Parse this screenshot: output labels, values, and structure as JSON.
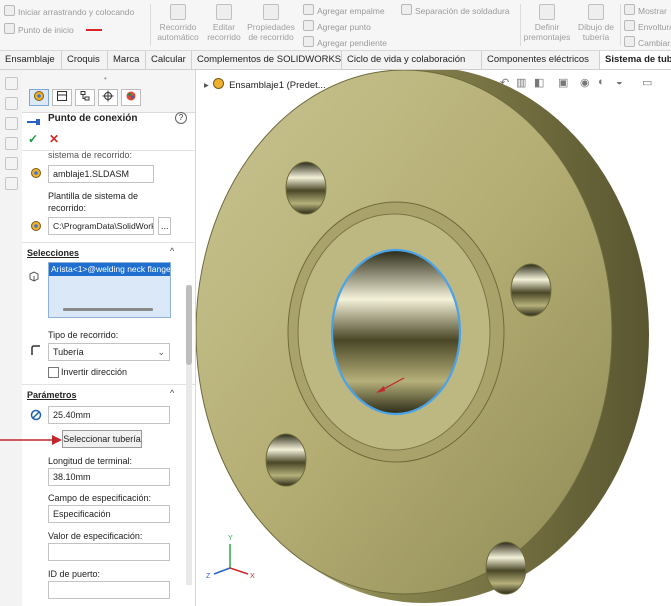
{
  "ribbon": {
    "small_items": [
      {
        "icon": "drag-route-icon",
        "label": "Iniciar arrastrando y colocando"
      },
      {
        "icon": "connection-point-icon",
        "label": "Punto de inicio"
      },
      {
        "icon": "add-elbow-icon",
        "label": "Agregar empalme"
      },
      {
        "icon": "add-point-icon",
        "label": "Agregar punto"
      },
      {
        "icon": "add-slope-icon",
        "label": "Agregar pendiente"
      },
      {
        "icon": "weld-gap-icon",
        "label": "Separación de soldadura"
      },
      {
        "icon": "show-icon",
        "label": "Mostrar"
      },
      {
        "icon": "covering-icon",
        "label": "Envoltura"
      },
      {
        "icon": "change-icon",
        "label": "Cambiar"
      }
    ],
    "big_items": [
      {
        "icon": "auto-route-icon",
        "line1": "Recorrido",
        "line2": "automático"
      },
      {
        "icon": "edit-route-icon",
        "line1": "Editar",
        "line2": "recorrido"
      },
      {
        "icon": "route-properties-icon",
        "line1": "Propiedades",
        "line2": "de recorrido"
      },
      {
        "icon": "define-assemblies-icon",
        "line1": "Definir",
        "line2": "premontajes"
      },
      {
        "icon": "pipe-drawing-icon",
        "line1": "Dibujo de",
        "line2": "tubería"
      }
    ]
  },
  "tabs": [
    "Ensamblaje",
    "Croquis",
    "Marca",
    "Calcular",
    "Complementos de SOLIDWORKS",
    "Ciclo de vida y colaboración",
    "Componentes eléctricos",
    "Sistema de tub"
  ],
  "active_tab_index": 7,
  "pm": {
    "title": "Punto de conexión",
    "route_label_partial": "sistema de recorrido:",
    "route_assembly": "amblaje1.SLDASM",
    "template_label": "Plantilla de sistema de recorrido:",
    "template_path": "C:\\ProgramData\\SolidWorks",
    "browse_label": "...",
    "selections_header": "Selecciones",
    "selection_item": "Arista<1>@welding neck flange",
    "route_type_label": "Tipo de recorrido:",
    "route_type_value": "Tubería",
    "reverse_label": "Invertir dirección",
    "parameters_header": "Parámetros",
    "diameter": "25.40mm",
    "select_pipe_button": "Seleccionar tubería",
    "stub_length_label": "Longitud de terminal:",
    "stub_length": "38.10mm",
    "spec_field_label": "Campo de especificación:",
    "spec_field_value": "Especificación",
    "spec_value_label": "Valor de especificación:",
    "spec_value": "",
    "port_id_label": "ID de puerto:",
    "port_id": ""
  },
  "tree": {
    "label": "Ensamblaje1 (Predet..."
  },
  "colors": {
    "flange": "#b4ae74",
    "selection_edge": "#4aa3e8",
    "accent": "#1e6fd0",
    "arrow": "#c0282d"
  }
}
